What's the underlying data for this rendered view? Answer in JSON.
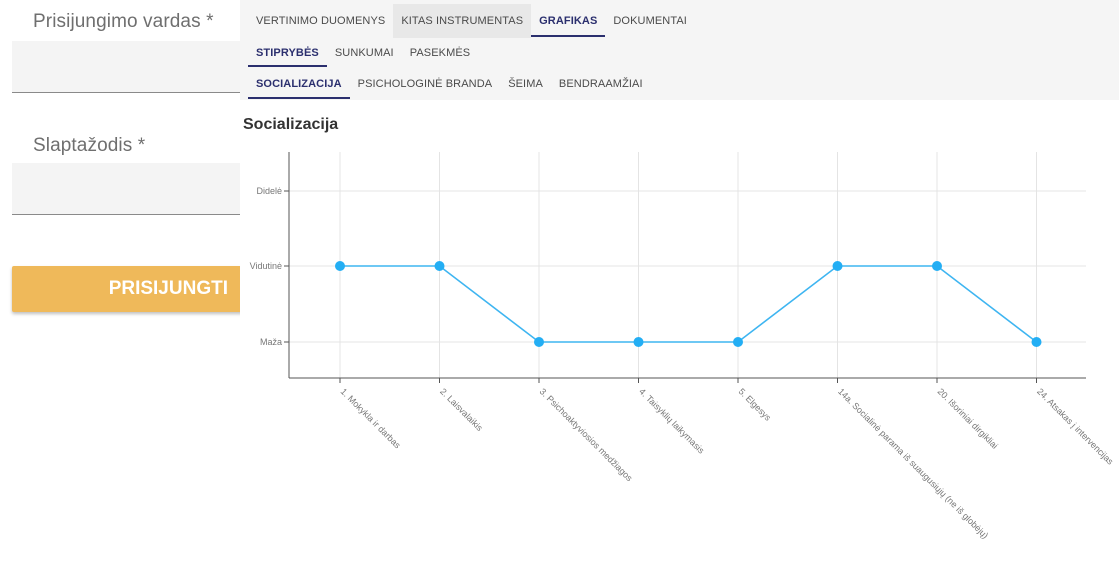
{
  "login": {
    "username_label": "Prisijungimo vardas *",
    "username_value": "",
    "password_label": "Slaptažodis *",
    "password_value": "",
    "submit_label": "PRISIJUNGTI"
  },
  "tabs_main": [
    {
      "label": "VERTINIMO DUOMENYS",
      "active": false
    },
    {
      "label": "KITAS INSTRUMENTAS",
      "active": false
    },
    {
      "label": "GRAFIKAS",
      "active": true
    },
    {
      "label": "DOKUMENTAI",
      "active": false
    }
  ],
  "tabs_sub": [
    {
      "label": "STIPRYBĖS",
      "active": true
    },
    {
      "label": "SUNKUMAI",
      "active": false
    },
    {
      "label": "PASEKMĖS",
      "active": false
    }
  ],
  "tabs_area": [
    {
      "label": "SOCIALIZACIJA",
      "active": true
    },
    {
      "label": "PSICHOLOGINĖ BRANDA",
      "active": false
    },
    {
      "label": "ŠEIMA",
      "active": false
    },
    {
      "label": "BENDRAAMŽIAI",
      "active": false
    }
  ],
  "chart_data": {
    "type": "line",
    "title": "Socializacija",
    "xlabel": "",
    "ylabel": "",
    "y_levels": [
      "Maža",
      "Vidutinė",
      "Didelė"
    ],
    "categories": [
      "1. Mokykla ir darbas",
      "2. Laisvalaikis",
      "3. Psichoaktyviosios medžiagos",
      "4. Taisyklių laikymasis",
      "5. Elgesys",
      "14a. Socialinė parama iš suaugusiųjų (ne iš globėjų)",
      "20. Išoriniai dirgikliai",
      "24. Atsakas į intervencijas"
    ],
    "series": [
      {
        "values": [
          "Vidutinė",
          "Vidutinė",
          "Maža",
          "Maža",
          "Maža",
          "Vidutinė",
          "Vidutinė",
          "Maža"
        ]
      }
    ],
    "grid": true,
    "colors": {
      "line": "#3eb5f1",
      "point": "#23aef4",
      "grid": "#e4e4e4",
      "axis": "#555555"
    }
  }
}
